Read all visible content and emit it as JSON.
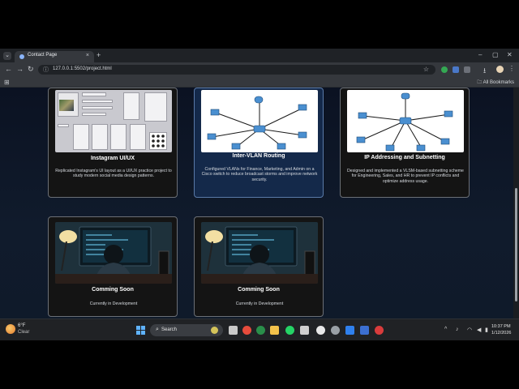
{
  "browser": {
    "tab_title": "Contact Page",
    "tab_close": "×",
    "new_tab": "+",
    "url": "127.0.0.1:5502/project.html",
    "bookmarks_label": "All Bookmarks",
    "icons": {
      "tab_list": "chevron-down-icon",
      "back": "back-arrow-icon",
      "forward": "forward-arrow-icon",
      "reload": "reload-icon",
      "star": "star-icon",
      "menu": "kebab-menu-icon"
    }
  },
  "projects": [
    {
      "title": "Instagram UI/UX",
      "description": "Replicated Instagram's UI layout as a UI/UX practice project to study modern social media design patterns.",
      "image": "instagram-mockup"
    },
    {
      "title": "Inter-VLAN Routing",
      "description": "Configured VLANs for Finance, Marketing, and Admin on a Cisco switch to reduce broadcast storms and improve network security.",
      "image": "network-diagram"
    },
    {
      "title": "IP Addressing and Subnetting",
      "description": "Designed and implemented a VLSM-based subnetting scheme for Engineering, Sales, and HR to prevent IP conflicts and optimize address usage.",
      "image": "network-diagram"
    },
    {
      "title": "Comming Soon",
      "description": "Currently in Development",
      "image": "developer-at-desk"
    },
    {
      "title": "Comming Soon",
      "description": "Currently in Development",
      "image": "developer-at-desk"
    }
  ],
  "taskbar": {
    "weather_temp": "6°F",
    "weather_desc": "Clear",
    "search_label": "Search",
    "time": "10:37 PM",
    "date": "1/12/2026"
  },
  "colors": {
    "page_bg": "#0f1826",
    "card_bg": "#141414",
    "card_highlight_bg": "#14294a",
    "taskbar_bg": "#202225"
  }
}
